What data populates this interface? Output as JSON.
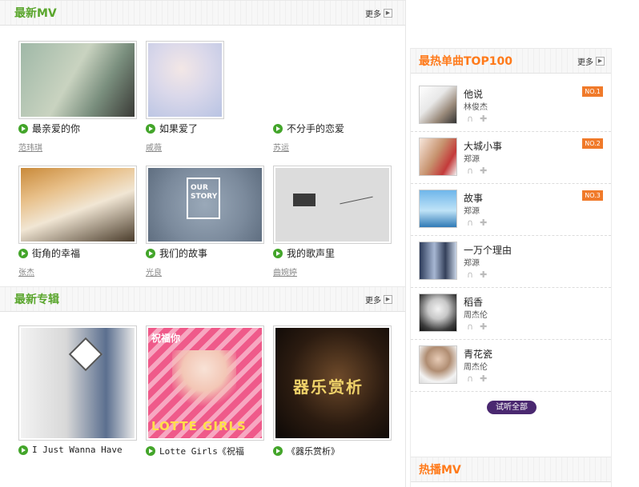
{
  "latest_mv": {
    "title": "最新MV",
    "more": "更多",
    "items": [
      {
        "title": "最亲爱的你",
        "artist": "范玮琪"
      },
      {
        "title": "如果爱了",
        "artist": "戚薇"
      },
      {
        "title": "不分手的恋爱",
        "artist": "苏运"
      },
      {
        "title": "街角的幸福",
        "artist": "张杰"
      },
      {
        "title": "我们的故事",
        "artist": "光良"
      },
      {
        "title": "我的歌声里",
        "artist": "曲婉婷"
      }
    ],
    "thumb_text": {
      "our_story": "OUR STORY"
    }
  },
  "latest_album": {
    "title": "最新专辑",
    "more": "更多",
    "items": [
      {
        "title": "I Just Wanna Have"
      },
      {
        "title": "Lotte Girls《祝福"
      },
      {
        "title": "《器乐赏析》"
      }
    ],
    "cover_text": {
      "blessing": "祝福你",
      "lotte": "LOTTE GIRLS",
      "appreciation": "器乐赏析"
    }
  },
  "top100": {
    "title": "最热单曲TOP100",
    "more": "更多",
    "items": [
      {
        "title": "他说",
        "singer": "林俊杰",
        "badge": "NO.1"
      },
      {
        "title": "大城小事",
        "singer": "郑源",
        "badge": "NO.2"
      },
      {
        "title": "故事",
        "singer": "郑源",
        "badge": "NO.3"
      },
      {
        "title": "一万个理由",
        "singer": "郑源"
      },
      {
        "title": "稻香",
        "singer": "周杰伦"
      },
      {
        "title": "青花瓷",
        "singer": "周杰伦"
      }
    ],
    "listen_all": "试听全部"
  },
  "hot_mv": {
    "title": "热播MV"
  },
  "colors": {
    "green": "#5aa62d",
    "orange": "#ff7a1a",
    "badge": "#f07a2a",
    "button": "#4a2870"
  }
}
